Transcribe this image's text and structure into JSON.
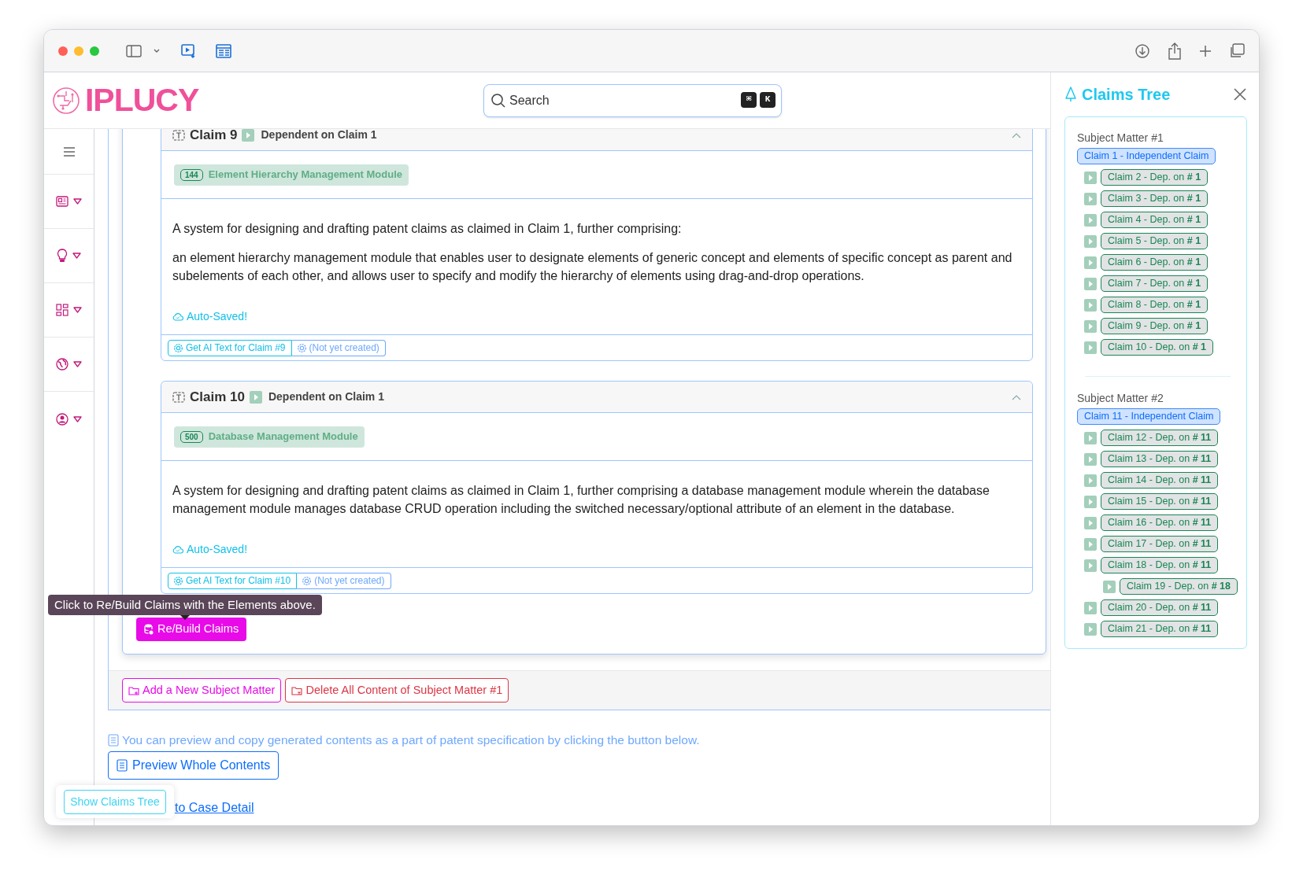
{
  "header": {
    "logo": "IPLUCY",
    "search": {
      "placeholder": "Search",
      "keys": [
        "⌘",
        "K"
      ]
    }
  },
  "claims": [
    {
      "title": "Claim 9",
      "dependency": "Dependent on **Claim 1**",
      "expanded": true,
      "element": {
        "number": "144",
        "name": "Element Hierarchy Management Module"
      },
      "paragraphs": [
        "A system for designing and drafting patent claims as claimed in Claim 1, further comprising:",
        "an element hierarchy management module that enables user to designate elements of generic concept and elements of specific concept as parent and subelements of each other, and allows user to specify and modify the hierarchy of elements using drag-and-drop operations."
      ],
      "save_status": "Auto-Saved!",
      "ai_button": "Get AI Text for Claim #9",
      "ai_status": "(Not yet created)"
    },
    {
      "title": "Claim 10",
      "dependency": "Dependent on **Claim 1**",
      "expanded": true,
      "element": {
        "number": "500",
        "name": "Database Management Module"
      },
      "paragraphs": [
        "A system for designing and drafting patent claims as claimed in Claim 1, further comprising a database management module wherein the database management module manages database CRUD operation including the switched necessary/optional attribute of an element in the database."
      ],
      "save_status": "Auto-Saved!",
      "ai_button": "Get AI Text for Claim #10",
      "ai_status": "(Not yet created)"
    }
  ],
  "rebuild": {
    "label": "Re/Build Claims",
    "tooltip": "Click to Re/Build Claims with the Elements above."
  },
  "actions": [
    {
      "kind": "add",
      "label": "Add a New Subject Matter"
    },
    {
      "kind": "delete",
      "label": "Delete All Content of Subject Matter #1"
    }
  ],
  "preview": {
    "hint": "You can preview and copy generated contents as a part of patent specification by clicking the button below.",
    "button": "Preview Whole Contents"
  },
  "back_link": "to Case Detail",
  "show_tree_button": "Show Claims Tree",
  "claims_tree": {
    "title": "Claims Tree",
    "groups": [
      {
        "title": "Subject Matter #1",
        "items": [
          {
            "kind": "independent",
            "label": "Claim 1 - Independent Claim"
          },
          {
            "kind": "dependent",
            "label": "Claim 2 - Dep. on **# 1**"
          },
          {
            "kind": "dependent",
            "label": "Claim 3 - Dep. on **# 1**"
          },
          {
            "kind": "dependent",
            "label": "Claim 4 - Dep. on **# 1**"
          },
          {
            "kind": "dependent",
            "label": "Claim 5 - Dep. on **# 1**"
          },
          {
            "kind": "dependent",
            "label": "Claim 6 - Dep. on **# 1**"
          },
          {
            "kind": "dependent",
            "label": "Claim 7 - Dep. on **# 1**"
          },
          {
            "kind": "dependent",
            "label": "Claim 8 - Dep. on **# 1**"
          },
          {
            "kind": "dependent",
            "label": "Claim 9 - Dep. on **# 1**"
          },
          {
            "kind": "dependent",
            "label": "Claim 10 - Dep. on **# 1**"
          }
        ]
      },
      {
        "title": "Subject Matter #2",
        "items": [
          {
            "kind": "independent",
            "label": "Claim 11 - Independent Claim"
          },
          {
            "kind": "dependent",
            "label": "Claim 12 - Dep. on **# 11**"
          },
          {
            "kind": "dependent",
            "label": "Claim 13 - Dep. on **# 11**"
          },
          {
            "kind": "dependent",
            "label": "Claim 14 - Dep. on **# 11**"
          },
          {
            "kind": "dependent",
            "label": "Claim 15 - Dep. on **# 11**"
          },
          {
            "kind": "dependent",
            "label": "Claim 16 - Dep. on **# 11**"
          },
          {
            "kind": "dependent",
            "label": "Claim 17 - Dep. on **# 11**"
          },
          {
            "kind": "dependent",
            "label": "Claim 18 - Dep. on **# 11**",
            "children": [
              {
                "kind": "dependent",
                "label": "Claim 19 - Dep. on **# 18**"
              }
            ]
          },
          {
            "kind": "dependent",
            "label": "Claim 20 - Dep. on **# 11**"
          },
          {
            "kind": "dependent",
            "label": "Claim 21 - Dep. on **# 11**"
          }
        ]
      }
    ]
  }
}
